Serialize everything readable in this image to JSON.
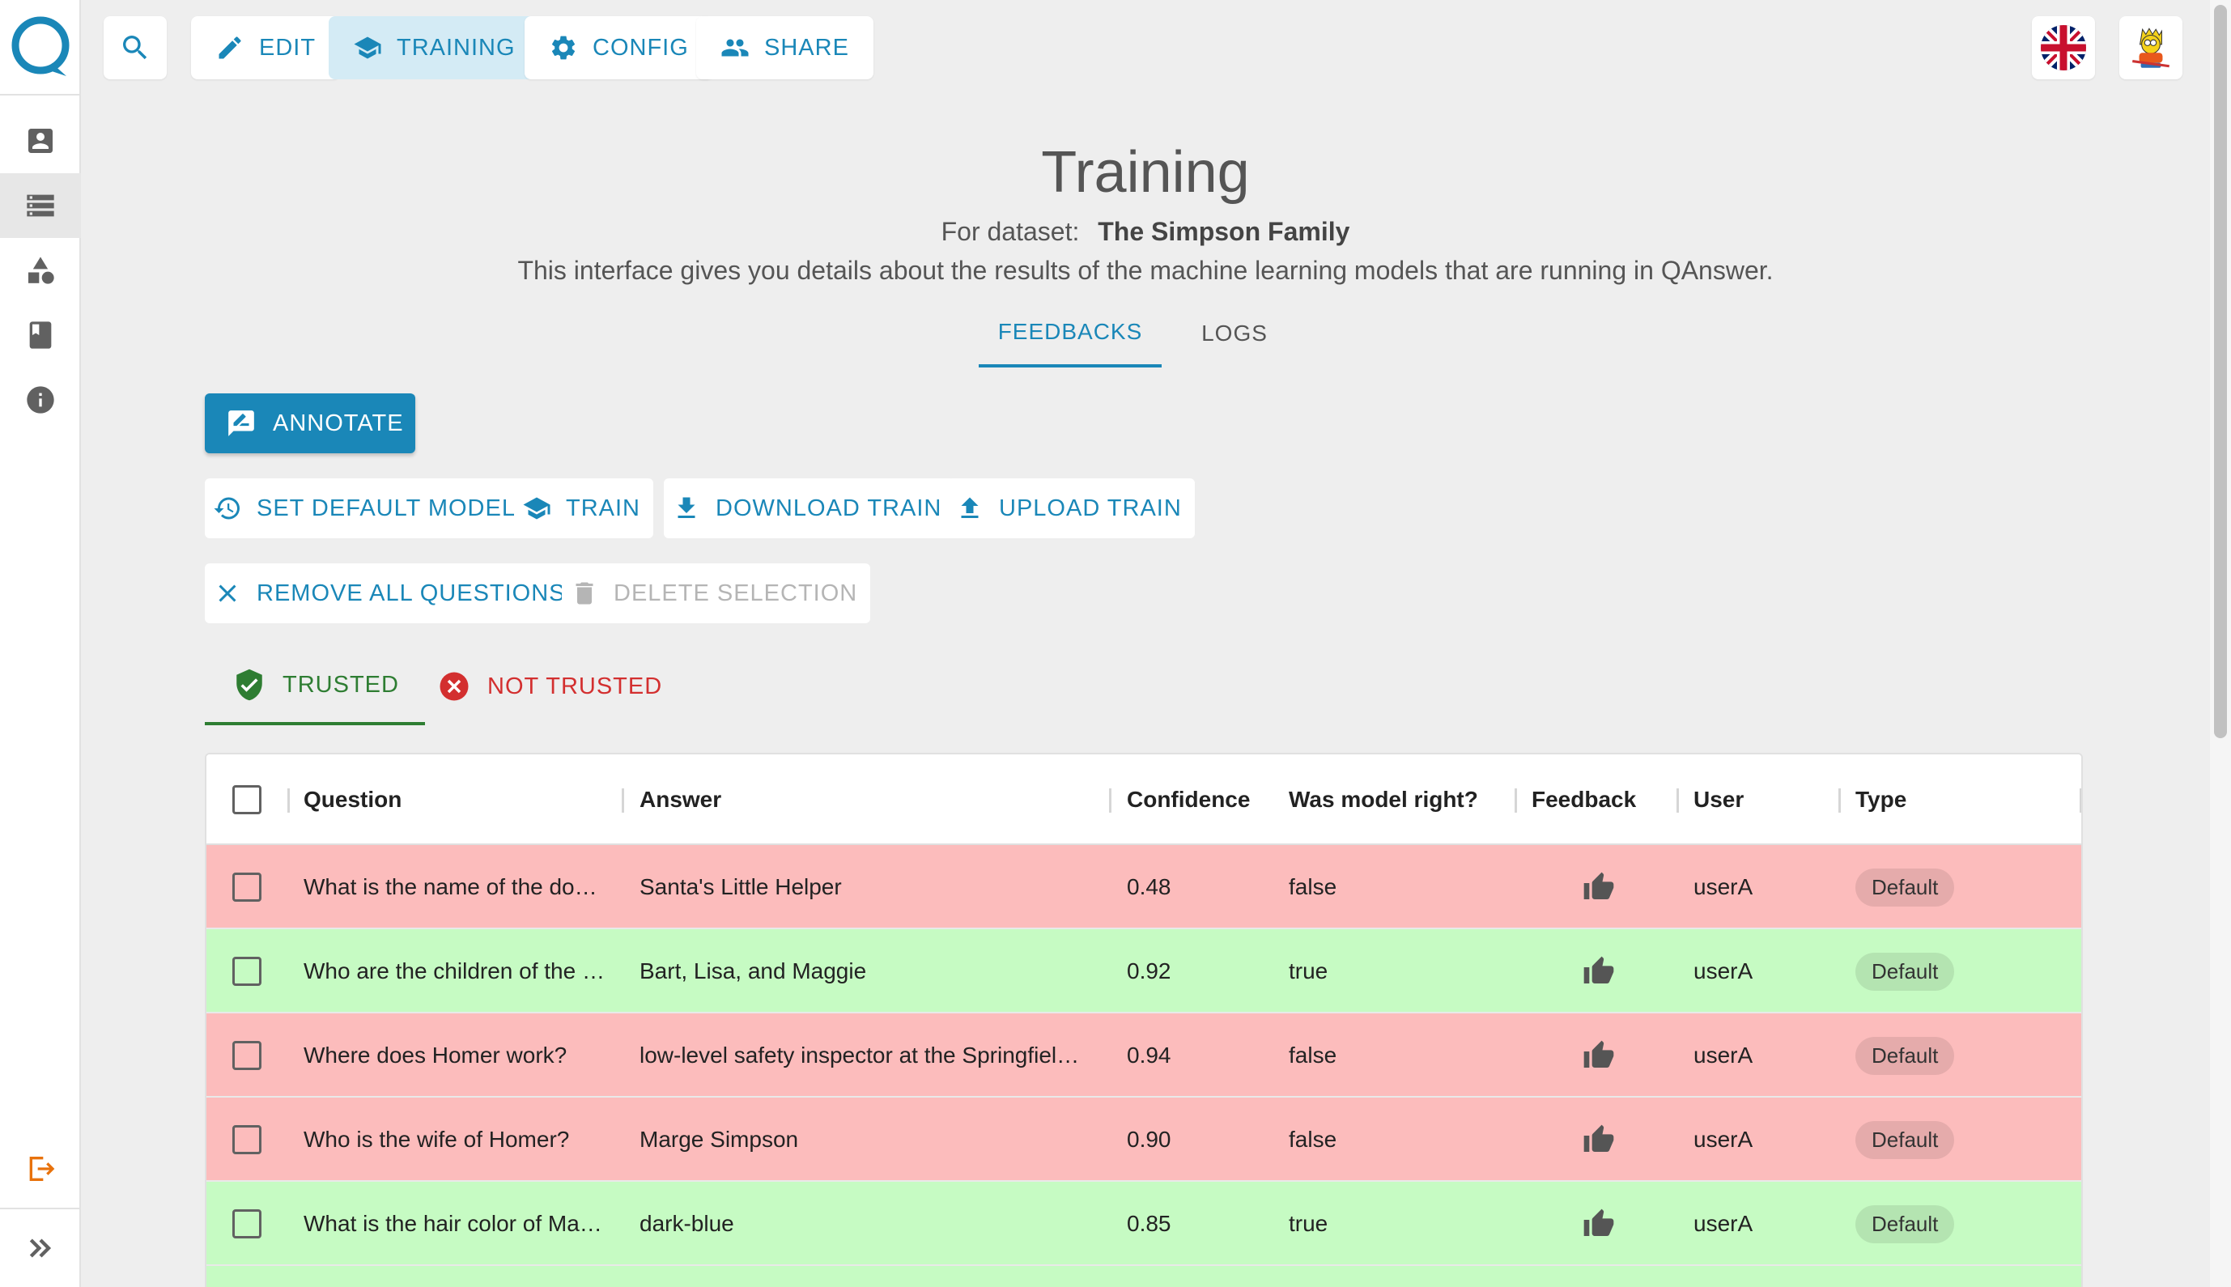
{
  "topbar": {
    "edit": "EDIT",
    "training": "TRAINING",
    "config": "CONFIG",
    "share": "SHARE"
  },
  "header": {
    "title": "Training",
    "dataset_prefix": "For dataset:",
    "dataset_name": "The Simpson Family",
    "description": "This interface gives you details about the results of the machine learning models that are running in QAnswer."
  },
  "tabs": {
    "feedbacks": "FEEDBACKS",
    "logs": "LOGS"
  },
  "actions": {
    "annotate": "ANNOTATE",
    "set_default_model": "SET DEFAULT MODEL",
    "train": "TRAIN",
    "download_train": "DOWNLOAD TRAIN",
    "upload_train": "UPLOAD TRAIN",
    "remove_all_questions": "REMOVE ALL QUESTIONS",
    "delete_selection": "DELETE SELECTION"
  },
  "trust_tabs": {
    "trusted": "TRUSTED",
    "not_trusted": "NOT TRUSTED"
  },
  "table": {
    "headers": {
      "question": "Question",
      "answer": "Answer",
      "confidence": "Confidence",
      "was_model_right": "Was model right?",
      "feedback": "Feedback",
      "user": "User",
      "type": "Type"
    },
    "rows": [
      {
        "question": "What is the name of the do…",
        "answer": "Santa's Little Helper",
        "confidence": "0.48",
        "right": "false",
        "user": "userA",
        "type": "Default"
      },
      {
        "question": "Who are the children of the …",
        "answer": "Bart, Lisa, and Maggie",
        "confidence": "0.92",
        "right": "true",
        "user": "userA",
        "type": "Default"
      },
      {
        "question": "Where does Homer work?",
        "answer": "low-level safety inspector at the Springfiel…",
        "confidence": "0.94",
        "right": "false",
        "user": "userA",
        "type": "Default"
      },
      {
        "question": "Who is the wife of Homer?",
        "answer": "Marge Simpson",
        "confidence": "0.90",
        "right": "false",
        "user": "userA",
        "type": "Default"
      },
      {
        "question": "What is the hair color of Ma…",
        "answer": "dark-blue",
        "confidence": "0.85",
        "right": "true",
        "user": "userA",
        "type": "Default"
      }
    ]
  },
  "colors": {
    "accent": "#1a87b8",
    "row_false": "#fcbcbc",
    "row_true": "#c6fbc3",
    "trusted": "#2e7d32",
    "not_trusted": "#d32f2f"
  }
}
